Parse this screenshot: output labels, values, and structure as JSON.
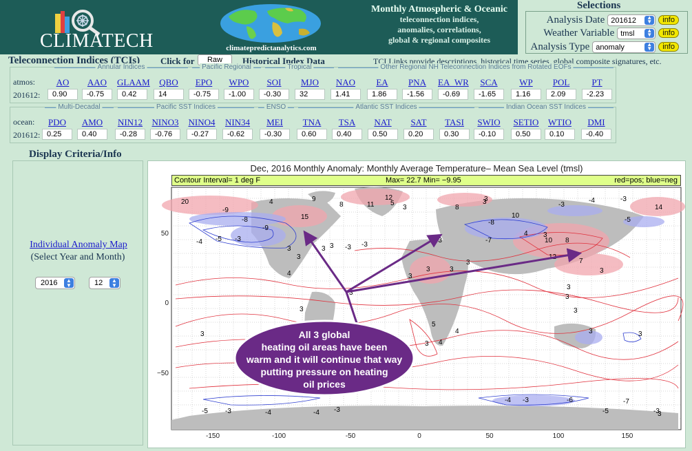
{
  "header": {
    "logo_text": "CLIMATECH",
    "site_url": "climatepredictanalytics.com",
    "tagline_lines": [
      "Monthly Atmospheric & Oceanic",
      "teleconnection indices,",
      "anomalies, correlations,",
      "global & regional composites"
    ]
  },
  "selections": {
    "title": "Selections",
    "rows": [
      {
        "label": "Analysis Date",
        "value": "201612",
        "info": "info"
      },
      {
        "label": "Weather Variable",
        "value": "tmsl",
        "info": "info"
      },
      {
        "label": "Analysis Type",
        "value": "anomaly",
        "info": "info"
      }
    ]
  },
  "tci": {
    "title": "Teleconnection Indices (TCIs)",
    "click_for": "Click for",
    "mode_value": "Raw",
    "historical_label": "Historical Index Data",
    "links_note": "TCI Links provide descriptions, historical time series, global composite signatures, etc.",
    "atmos": {
      "row_label": "atmos:",
      "date_label": "201612:",
      "groups": [
        "Annular Indices",
        "Pacific Regional",
        "Tropical",
        "Other Regional NH Teleconnection Indices from Rotated EOFs"
      ],
      "indices": [
        {
          "name": "AO",
          "value": "0.90"
        },
        {
          "name": "AAO",
          "value": "-0.75"
        },
        {
          "name": "GLAAM",
          "value": "0.42"
        },
        {
          "name": "QBO",
          "value": "14"
        },
        {
          "name": "EPO",
          "value": "-0.75"
        },
        {
          "name": "WPO",
          "value": "-1.00"
        },
        {
          "name": "SOI",
          "value": "-0.30"
        },
        {
          "name": "MJO",
          "value": "32"
        },
        {
          "name": "NAO",
          "value": "1.41"
        },
        {
          "name": "EA",
          "value": "1.86"
        },
        {
          "name": "PNA",
          "value": "-1.56"
        },
        {
          "name": "EA_WR",
          "value": "-0.69"
        },
        {
          "name": "SCA",
          "value": "-1.65"
        },
        {
          "name": "WP",
          "value": "1.16"
        },
        {
          "name": "POL",
          "value": "2.09"
        },
        {
          "name": "PT",
          "value": "-2.23"
        }
      ]
    },
    "ocean": {
      "row_label": "ocean:",
      "date_label": "201612:",
      "groups": [
        "Multi-Decadal",
        "Pacific SST Indices",
        "ENSO",
        "Atlantic SST Indices",
        "Indian Ocean SST Indices"
      ],
      "indices": [
        {
          "name": "PDO",
          "value": "0.25"
        },
        {
          "name": "AMO",
          "value": "0.40"
        },
        {
          "name": "NIN12",
          "value": "-0.28"
        },
        {
          "name": "NINO3",
          "value": "-0.76"
        },
        {
          "name": "NINO4",
          "value": "-0.27"
        },
        {
          "name": "NIN34",
          "value": "-0.62"
        },
        {
          "name": "MEI",
          "value": "-0.30"
        },
        {
          "name": "TNA",
          "value": "0.60"
        },
        {
          "name": "TSA",
          "value": "0.40"
        },
        {
          "name": "NAT",
          "value": "0.50"
        },
        {
          "name": "SAT",
          "value": "0.20"
        },
        {
          "name": "TASI",
          "value": "0.30"
        },
        {
          "name": "SWIO",
          "value": "-0.10"
        },
        {
          "name": "SETIO",
          "value": "0.50"
        },
        {
          "name": "WTIO",
          "value": "0.10"
        },
        {
          "name": "DMI",
          "value": "-0.40"
        }
      ]
    }
  },
  "display": {
    "title": "Display Criteria/Info",
    "map_link": "Individual Anomaly Map",
    "map_sub": "(Select Year and Month)",
    "year": "2016",
    "month": "12"
  },
  "map": {
    "title": "Dec, 2016   Monthly Anomaly: Monthly Average Temperature– Mean Sea Level (tmsl)",
    "contour_interval": "Contour Interval= 1 deg F",
    "maxmin": "Max= 22.7  Min= −9.95",
    "legend_note": "red=pos; blue=neg",
    "x_ticks": [
      "-150",
      "-100",
      "-50",
      "0",
      "50",
      "100",
      "150"
    ],
    "y_ticks": [
      "50",
      "0",
      "−50"
    ],
    "annotation": [
      "All 3 global",
      "heating oil areas have been",
      "warm and it will continue that way",
      "putting pressure on heating",
      "oil prices"
    ],
    "contour_labels": {
      "pos": [
        "20",
        "4",
        "9",
        "8",
        "11",
        "12",
        "15",
        "5",
        "8",
        "3",
        "10",
        "14",
        "4",
        "10",
        "8",
        "12",
        "7",
        "5",
        "4",
        "4",
        "3",
        "4"
      ],
      "neg": [
        "-9",
        "-8",
        "-9",
        "-4",
        "-5",
        "-3",
        "-3",
        "-3",
        "-3",
        "-8",
        "-5",
        "-7",
        "-3",
        "-4",
        "-5",
        "-3",
        "-4",
        "-4",
        "-3",
        "-6",
        "-7",
        "-4",
        "-3",
        "-3",
        "-5",
        "-3",
        "-3"
      ],
      "plain": [
        "3",
        "3",
        "3",
        "3",
        "3",
        "3",
        "3",
        "3",
        "3",
        "3",
        "3",
        "3",
        "3",
        "3",
        "3",
        "3",
        "3",
        "3",
        "3",
        "3",
        "3"
      ]
    }
  },
  "colors": {
    "header_bg": "#1d5c57",
    "page_bg": "#cfe8d6",
    "link": "#1a1acc",
    "info_button": "#f2e700",
    "positive_contour": "#e0303c",
    "negative_contour": "#2f3fd0",
    "annotation_fill": "#6a2a86"
  }
}
